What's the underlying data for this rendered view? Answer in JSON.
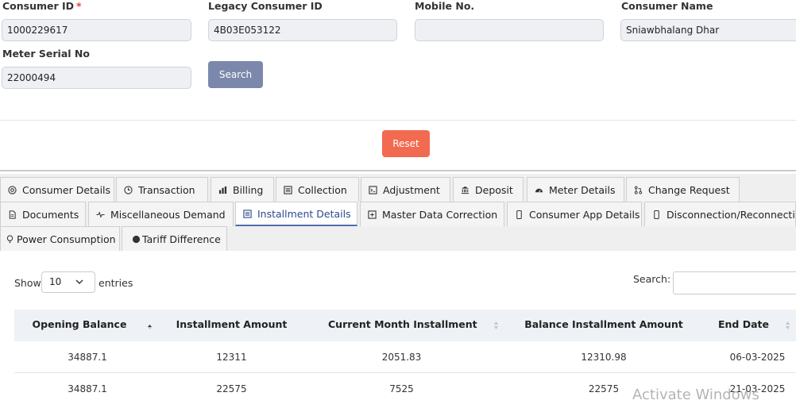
{
  "form": {
    "consumer_id": {
      "label": "Consumer ID",
      "required_mark": "*",
      "value": "1000229617"
    },
    "legacy_consumer_id": {
      "label": "Legacy Consumer ID",
      "value": "4B03E053122"
    },
    "mobile_no": {
      "label": "Mobile No.",
      "value": ""
    },
    "consumer_name": {
      "label": "Consumer Name",
      "value": "Sniawbhalang Dhar"
    },
    "meter_serial_no": {
      "label": "Meter Serial No",
      "value": "22000494"
    },
    "search_button": "Search",
    "reset_button": "Reset"
  },
  "tabs": [
    {
      "label": "Consumer Details",
      "icon": "target-icon"
    },
    {
      "label": "Transaction",
      "icon": "clock-icon"
    },
    {
      "label": "Billing",
      "icon": "bar-chart-icon"
    },
    {
      "label": "Collection",
      "icon": "list-icon"
    },
    {
      "label": "Adjustment",
      "icon": "terminal-icon"
    },
    {
      "label": "Deposit",
      "icon": "bank-icon"
    },
    {
      "label": "Meter Details",
      "icon": "gauge-icon"
    },
    {
      "label": "Change Request",
      "icon": "git-pull-icon"
    },
    {
      "label": "Documents",
      "icon": "document-icon"
    },
    {
      "label": "Miscellaneous Demand",
      "icon": "activity-icon"
    },
    {
      "label": "Installment Details",
      "icon": "list-icon",
      "active": true
    },
    {
      "label": "Master Data Correction",
      "icon": "plus-square-icon"
    },
    {
      "label": "Consumer App Details",
      "icon": "phone-icon"
    },
    {
      "label": "Disconnection/Reconnection",
      "icon": "phone-icon"
    },
    {
      "label": "Power Consumption",
      "icon": "bulb-icon"
    },
    {
      "label": "Tariff Difference",
      "icon": "circle-icon"
    }
  ],
  "table_controls": {
    "show_label": "Show",
    "page_length": "10",
    "entries_label": "entries",
    "search_label": "Search:",
    "search_value": ""
  },
  "table": {
    "columns": [
      "Opening Balance",
      "Installment Amount",
      "Current Month Installment",
      "Balance Installment Amount",
      "End Date"
    ],
    "rows": [
      [
        "34887.1",
        "12311",
        "2051.83",
        "12310.98",
        "06-03-2025"
      ],
      [
        "34887.1",
        "22575",
        "7525",
        "22575",
        "21-03-2025"
      ]
    ]
  },
  "watermark": "Activate Windows",
  "colors": {
    "search_button": "#7b88ab",
    "reset_button": "#f26a4f",
    "active_tab": "#4f6db0",
    "table_header": "#eef1f6"
  }
}
